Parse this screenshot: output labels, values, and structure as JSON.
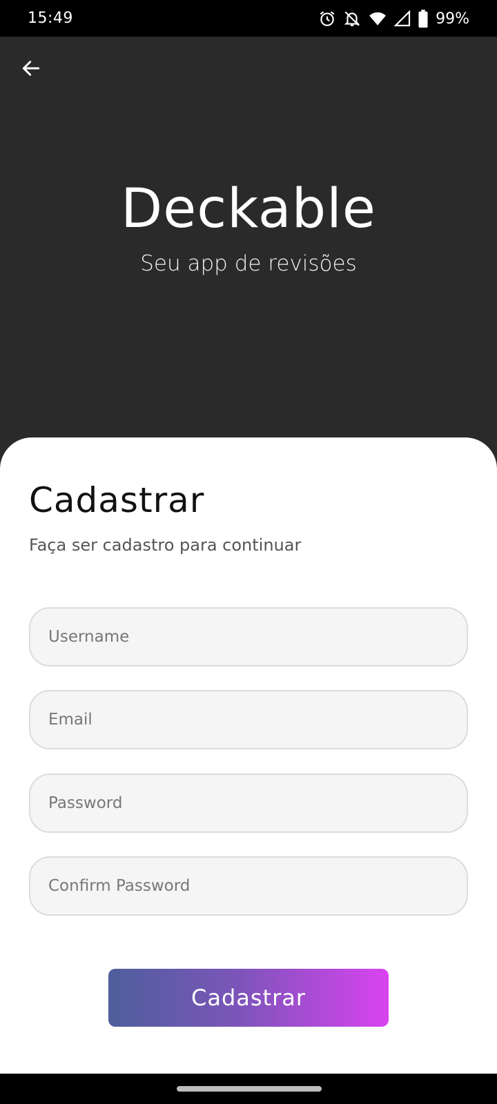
{
  "status_bar": {
    "time": "15:49",
    "battery": "99%",
    "icons": [
      "alarm-icon",
      "notifications-off-icon",
      "wifi-icon",
      "signal-icon",
      "battery-icon"
    ]
  },
  "header": {
    "back_icon": "arrow-left-icon",
    "title": "Deckable",
    "subtitle": "Seu app de revisões"
  },
  "form": {
    "title": "Cadastrar",
    "subtitle": "Faça ser cadastro para continuar",
    "fields": [
      {
        "placeholder": "Username",
        "value": ""
      },
      {
        "placeholder": "Email",
        "value": ""
      },
      {
        "placeholder": "Password",
        "value": ""
      },
      {
        "placeholder": "Confirm Password",
        "value": ""
      }
    ],
    "submit_label": "Cadastrar"
  },
  "colors": {
    "header_bg": "#2a2a2a",
    "card_bg": "#ffffff",
    "button_gradient_start": "#4e5f9c",
    "button_gradient_end": "#d943f0"
  }
}
